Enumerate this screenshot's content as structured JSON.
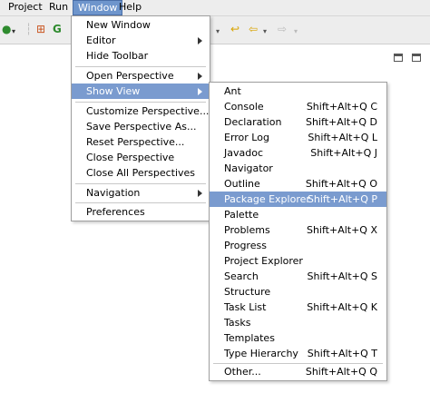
{
  "menubar": {
    "items": [
      {
        "label": "Project"
      },
      {
        "label": "Run"
      },
      {
        "label": "Window",
        "active": true
      },
      {
        "label": "Help"
      }
    ]
  },
  "window_menu": {
    "items": [
      {
        "label": "New Window"
      },
      {
        "label": "Editor",
        "submenu": true
      },
      {
        "label": "Hide Toolbar"
      },
      {
        "label": "Open Perspective",
        "submenu": true
      },
      {
        "label": "Show View",
        "submenu": true,
        "highlighted": true
      },
      {
        "label": "Customize Perspective..."
      },
      {
        "label": "Save Perspective As..."
      },
      {
        "label": "Reset Perspective..."
      },
      {
        "label": "Close Perspective"
      },
      {
        "label": "Close All Perspectives"
      },
      {
        "label": "Navigation",
        "submenu": true
      },
      {
        "label": "Preferences"
      }
    ]
  },
  "show_view_menu": {
    "items": [
      {
        "label": "Ant",
        "shortcut": ""
      },
      {
        "label": "Console",
        "shortcut": "Shift+Alt+Q C"
      },
      {
        "label": "Declaration",
        "shortcut": "Shift+Alt+Q D"
      },
      {
        "label": "Error Log",
        "shortcut": "Shift+Alt+Q L"
      },
      {
        "label": "Javadoc",
        "shortcut": "Shift+Alt+Q J"
      },
      {
        "label": "Navigator",
        "shortcut": ""
      },
      {
        "label": "Outline",
        "shortcut": "Shift+Alt+Q O"
      },
      {
        "label": "Package Explorer",
        "shortcut": "Shift+Alt+Q P",
        "highlighted": true
      },
      {
        "label": "Palette",
        "shortcut": ""
      },
      {
        "label": "Problems",
        "shortcut": "Shift+Alt+Q X"
      },
      {
        "label": "Progress",
        "shortcut": ""
      },
      {
        "label": "Project Explorer",
        "shortcut": ""
      },
      {
        "label": "Search",
        "shortcut": "Shift+Alt+Q S"
      },
      {
        "label": "Structure",
        "shortcut": ""
      },
      {
        "label": "Task List",
        "shortcut": "Shift+Alt+Q K"
      },
      {
        "label": "Tasks",
        "shortcut": ""
      },
      {
        "label": "Templates",
        "shortcut": ""
      },
      {
        "label": "Type Hierarchy",
        "shortcut": "Shift+Alt+Q T"
      },
      {
        "label": "Other...",
        "shortcut": "Shift+Alt+Q Q"
      }
    ]
  },
  "toolbar_icons": [
    "run-icon",
    "new-class-icon",
    "refresh-icon",
    "next-annotation-icon",
    "back-icon",
    "forward-icon"
  ],
  "colors": {
    "highlight": "#7a9bcf",
    "menubar_active": "#6e95cc"
  }
}
